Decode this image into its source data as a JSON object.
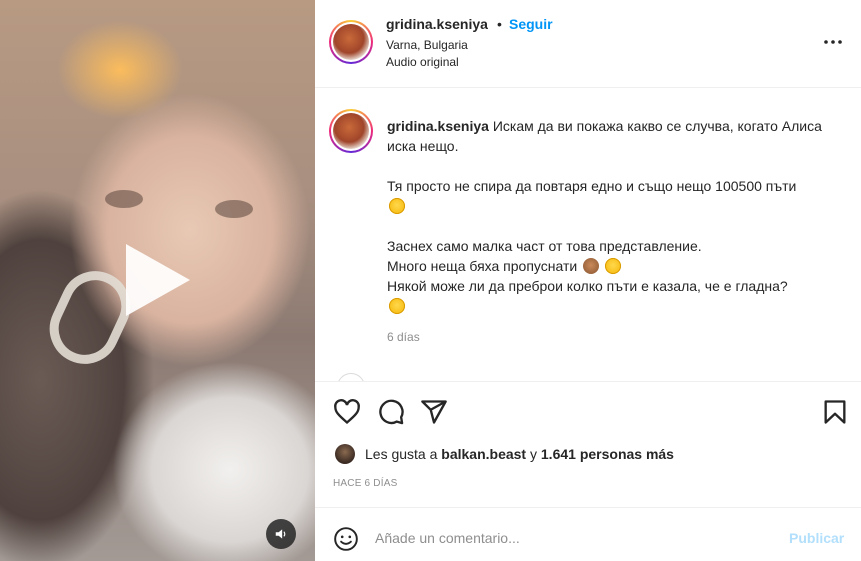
{
  "post": {
    "username": "gridina.kseniya",
    "follow_label": "Seguir",
    "separator": "•",
    "location": "Varna, Bulgaria",
    "audio": "Audio original"
  },
  "caption": {
    "username": "gridina.kseniya",
    "line1": "Искам да ви покажа какво се случва, когато Алиса иска нещо.",
    "line2": "Тя просто не спира да повтаря едно и също нещо 100500 пъти",
    "line3": "Заснех само малка част от това представление.",
    "line4": "Много неща бяха пропуснати",
    "line5": "Някой може ли да преброи колко пъти е казала, че е гладна?",
    "time": "6 días"
  },
  "likes": {
    "prefix": "Les gusta a",
    "user": "balkan.beast",
    "conj": "y",
    "others": "1.641 personas más"
  },
  "posted_ago": "HACE 6 DÍAS",
  "comment": {
    "placeholder": "Añade un comentario...",
    "publish_label": "Publicar"
  },
  "colors": {
    "link": "#0095f6",
    "muted": "#8e8e8e",
    "publish_disabled": "#b2dffc"
  }
}
